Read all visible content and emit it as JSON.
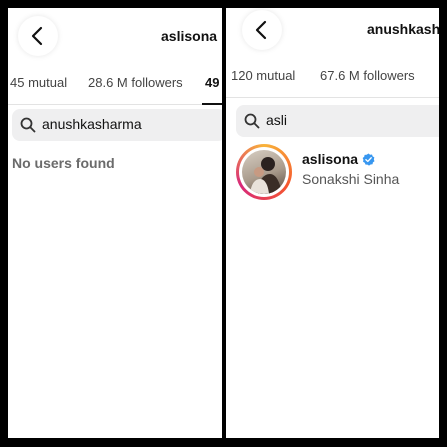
{
  "left_screen": {
    "header": {
      "username": "aslisona"
    },
    "tabs": [
      {
        "label": "45 mutual"
      },
      {
        "label": "28.6 M followers"
      },
      {
        "label": "49"
      }
    ],
    "search": {
      "query": "anushkasharma"
    },
    "empty_message": "No users found"
  },
  "right_screen": {
    "header": {
      "username": "anushkash"
    },
    "tabs": [
      {
        "label": "120 mutual"
      },
      {
        "label": "67.6 M followers"
      }
    ],
    "search": {
      "query": "asli"
    },
    "result": {
      "username": "aslisona",
      "full_name": "Sonakshi Sinha",
      "verified": true
    }
  },
  "colors": {
    "verified_badge": "#3897f0",
    "search_bg": "#efeff0",
    "story_ring": [
      "#f9b43a",
      "#f5572e",
      "#d7287a"
    ]
  },
  "icons": [
    "back-chevron-icon",
    "search-icon",
    "verified-badge-icon"
  ]
}
